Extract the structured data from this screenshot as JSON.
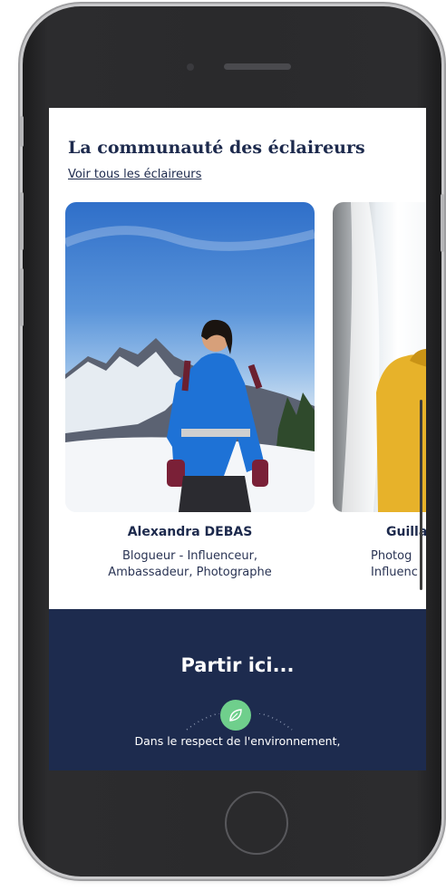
{
  "community": {
    "title": "La communauté des éclaireurs",
    "see_all_label": "Voir tous les éclaireurs"
  },
  "scouts": [
    {
      "name": "Alexandra DEBAS",
      "role_line1": "Blogueur - Influenceur,",
      "role_line2": "Ambassadeur, Photographe",
      "jacket_color": "#1e72d6"
    },
    {
      "name": "Guilla",
      "role_line1": "Photog",
      "role_line2": "Influenc",
      "jacket_color": "#e7b22a"
    }
  ],
  "promo": {
    "title": "Partir ici...",
    "text": "Dans le respect de l'environnement,"
  },
  "colors": {
    "navy": "#1d2b4e",
    "leaf_green": "#6fcf8c"
  }
}
